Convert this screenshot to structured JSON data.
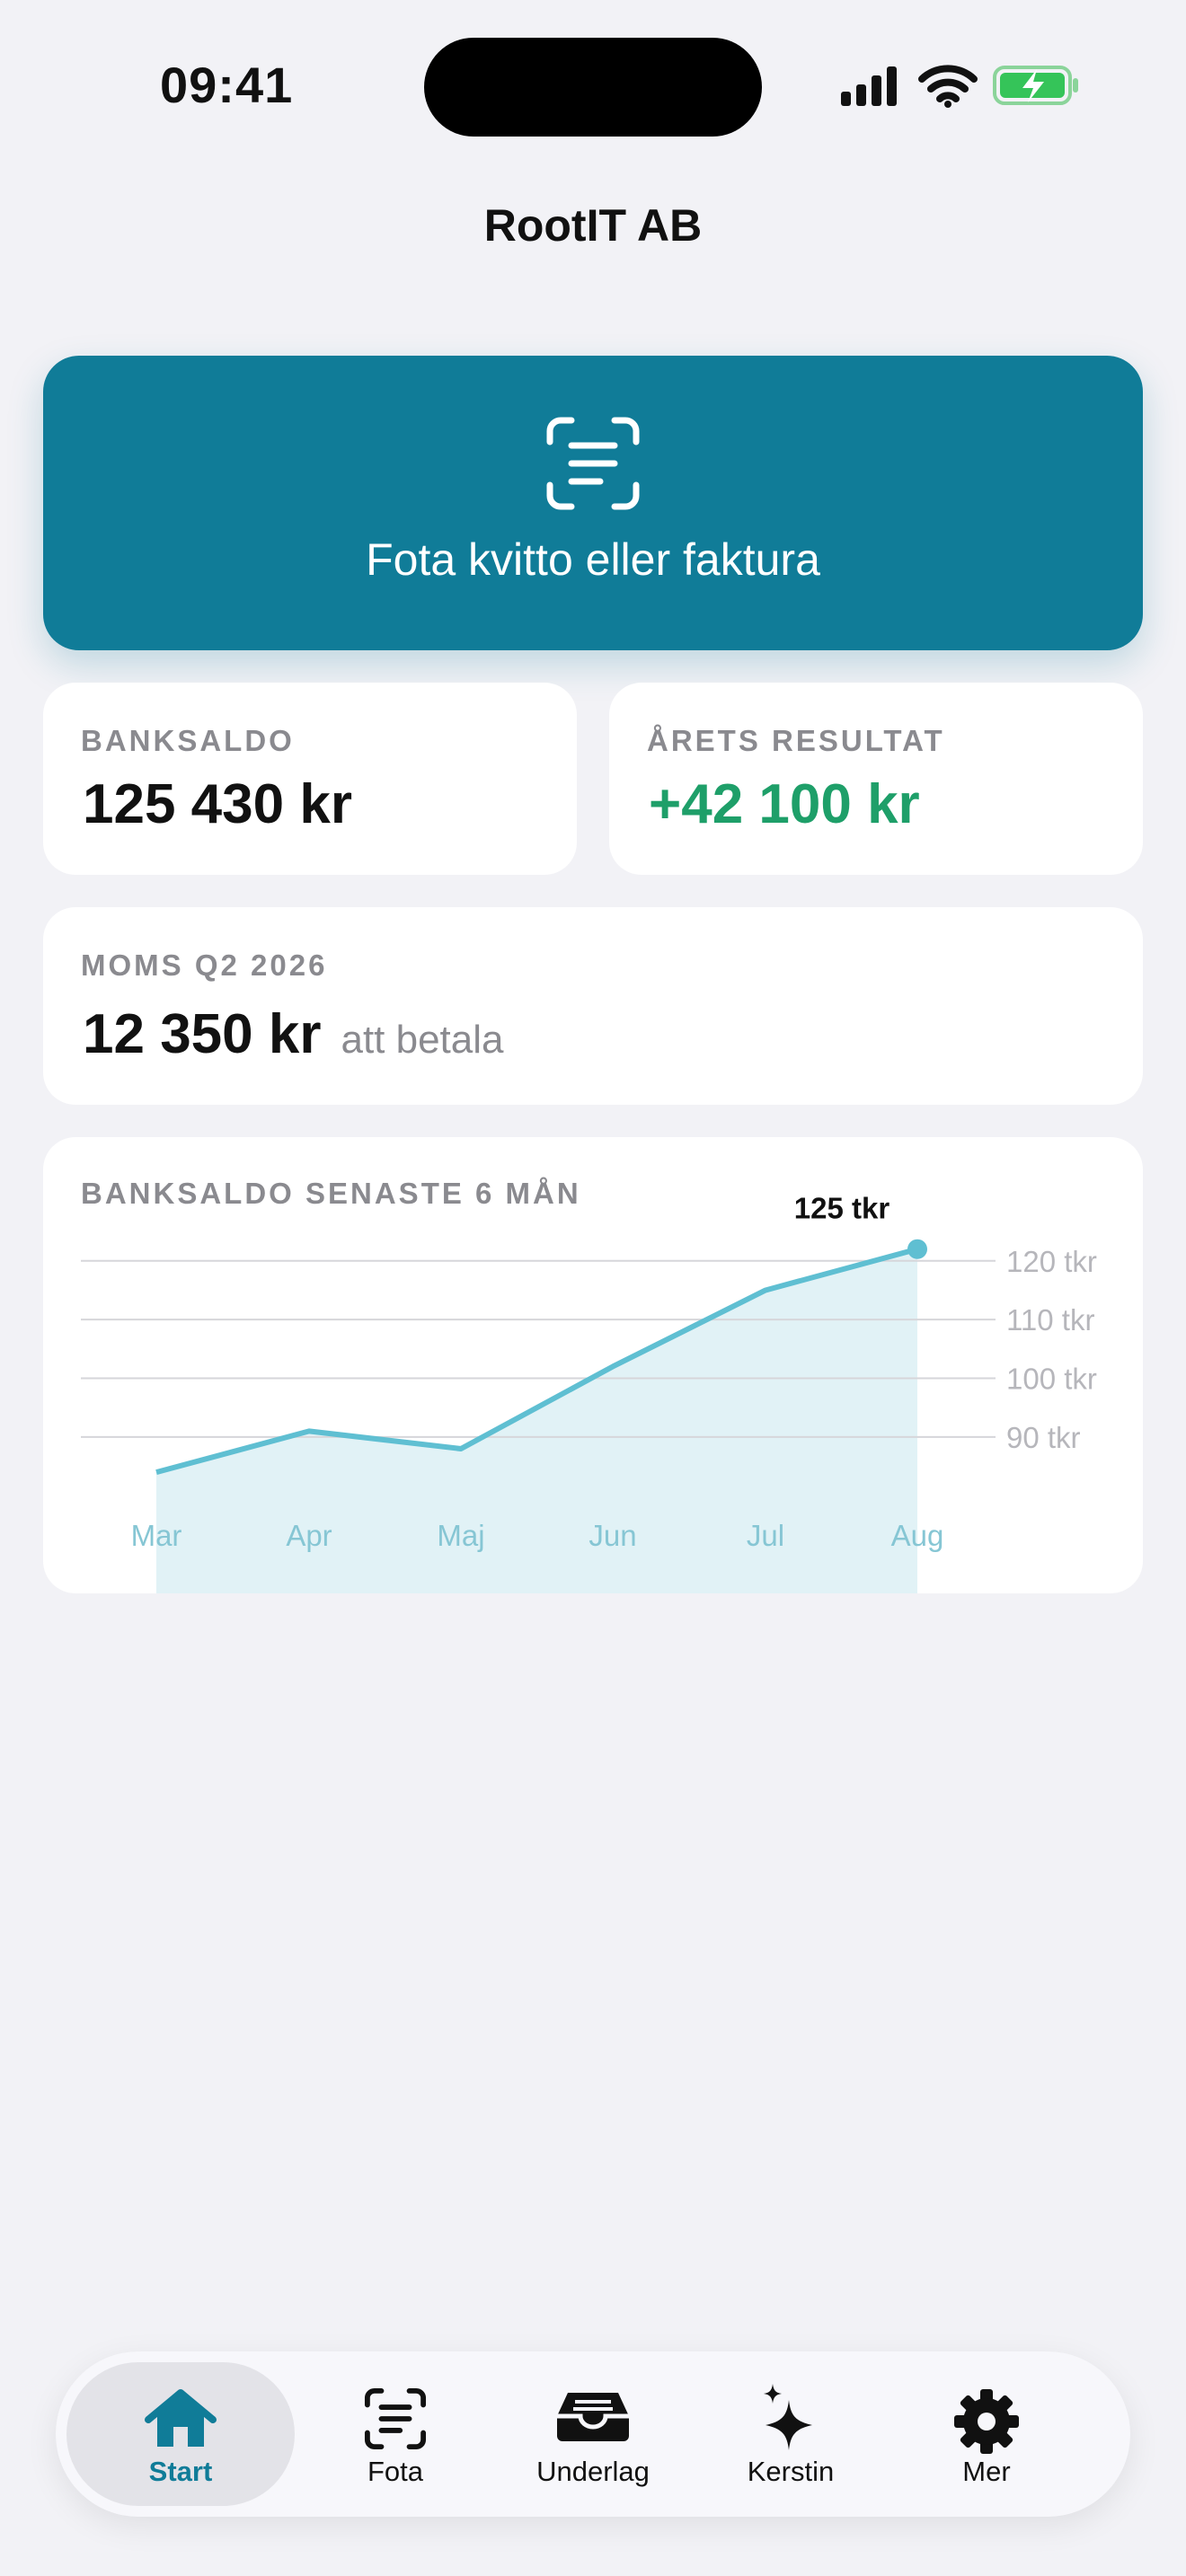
{
  "status": {
    "time": "09:41"
  },
  "header": {
    "company": "RootIT AB"
  },
  "scan_button": {
    "label": "Fota kvitto eller faktura",
    "icon": "document-scanner-icon"
  },
  "cards": {
    "bank": {
      "label": "BANKSALDO",
      "value": "125 430 kr"
    },
    "result": {
      "label": "ÅRETS RESULTAT",
      "value": "+42 100 kr",
      "color": "#1e9f69"
    },
    "vat": {
      "label": "MOMS Q2 2026",
      "value": "12 350 kr",
      "suffix": "att betala"
    }
  },
  "chart_card": {
    "label": "BANKSALDO SENASTE 6 MÅN"
  },
  "chart_data": {
    "type": "area",
    "categories": [
      "Mar",
      "Apr",
      "Maj",
      "Jun",
      "Jul",
      "Aug"
    ],
    "values": [
      84,
      91,
      88,
      102,
      115,
      122
    ],
    "y_ticks": [
      90,
      100,
      110,
      120
    ],
    "y_tick_labels": [
      "90 tkr",
      "100 tkr",
      "110 tkr",
      "120 tkr"
    ],
    "ylim": [
      75,
      127
    ],
    "last_value_label": "125 tkr",
    "line_color": "#5fbfd2",
    "fill_color": "#dff1f6",
    "grid": true
  },
  "tabs": [
    {
      "label": "Start",
      "icon": "house-icon",
      "active": true
    },
    {
      "label": "Fota",
      "icon": "document-scanner-icon",
      "active": false
    },
    {
      "label": "Underlag",
      "icon": "inbox-tray-icon",
      "active": false
    },
    {
      "label": "Kerstin",
      "icon": "sparkles-icon",
      "active": false
    },
    {
      "label": "Mer",
      "icon": "gear-icon",
      "active": false
    }
  ],
  "colors": {
    "accent": "#107c98",
    "background": "#f2f2f6",
    "positive": "#1e9f69"
  }
}
